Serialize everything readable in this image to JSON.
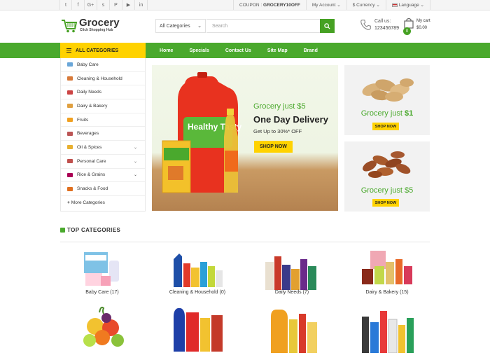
{
  "topbar": {
    "social_icons": [
      "twitter-icon",
      "facebook-icon",
      "google-plus-icon",
      "skype-icon",
      "pinterest-icon",
      "youtube-icon",
      "linkedin-icon"
    ],
    "social_glyphs": [
      "t",
      "f",
      "G+",
      "s",
      "P",
      "▶",
      "in"
    ],
    "coupon_label": "COUPON :",
    "coupon_code": "GROCERY10OFF",
    "account": "My Account",
    "currency": "$ Currency",
    "language": "Language"
  },
  "header": {
    "logo_name": "Grocery",
    "logo_tagline": "Click Shopping Hub",
    "category_select": "All Categories",
    "search_placeholder": "Search",
    "call_label": "Call us:",
    "call_number": "123456789",
    "cart_label": "My cart",
    "cart_total": "$0.00",
    "cart_count": "0"
  },
  "nav": {
    "all_categories": "ALL CATEGORIES",
    "menu": [
      "Home",
      "Specials",
      "Contact Us",
      "Site Map",
      "Brand"
    ]
  },
  "sidebar": {
    "items": [
      {
        "label": "Baby Care",
        "color": "#6aa6d8",
        "submenu": false
      },
      {
        "label": "Cleaning & Household",
        "color": "#d87a3a",
        "submenu": false
      },
      {
        "label": "Daily Needs",
        "color": "#c44",
        "submenu": false
      },
      {
        "label": "Dairy & Bakery",
        "color": "#e0a040",
        "submenu": false
      },
      {
        "label": "Fruits",
        "color": "#f0a020",
        "submenu": false
      },
      {
        "label": "Beverages",
        "color": "#b55",
        "submenu": false
      },
      {
        "label": "Oil & Spices",
        "color": "#e8b030",
        "submenu": true
      },
      {
        "label": "Personal Care",
        "color": "#c0504d",
        "submenu": true
      },
      {
        "label": "Rice & Grains",
        "color": "#a05",
        "submenu": true
      },
      {
        "label": "Snacks & Food",
        "color": "#e07020",
        "submenu": false
      }
    ],
    "more": "More Categories"
  },
  "banner": {
    "line1": "Grocery just $5",
    "line2": "One Day Delivery",
    "line3": "Get Up to 30%* OFF",
    "button": "SHOP NOW",
    "product_brand": "Healthy Tasty"
  },
  "promos": [
    {
      "prefix": "Grocery just ",
      "price": "$1",
      "button": "SHOP NOW"
    },
    {
      "prefix": "Grocery just ",
      "price": "$5",
      "button": "SHOP NOW"
    }
  ],
  "top_categories": {
    "title": "TOP CATEGORIES",
    "items": [
      {
        "label": "Baby Care (17)"
      },
      {
        "label": "Cleaning & Household (0)"
      },
      {
        "label": "Daily Needs (7)"
      },
      {
        "label": "Dairy & Bakery (15)"
      },
      {
        "label": ""
      },
      {
        "label": ""
      },
      {
        "label": ""
      },
      {
        "label": ""
      }
    ]
  },
  "colors": {
    "brand_green": "#4aa92d",
    "accent_yellow": "#ffd200"
  }
}
